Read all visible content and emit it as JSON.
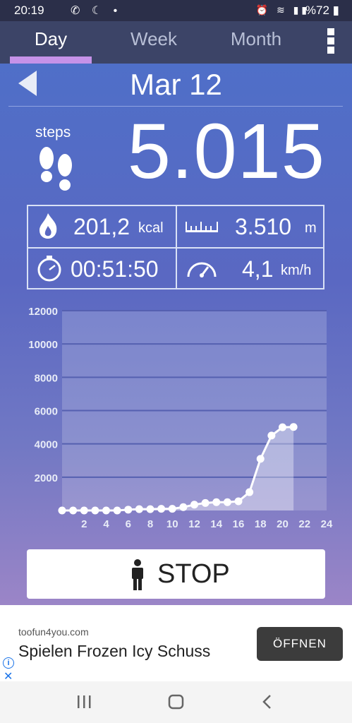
{
  "status_bar": {
    "time": "20:19",
    "left_icons": "whatsapp-icon moon-icon dot",
    "battery_text": "%72"
  },
  "tabs": [
    {
      "label": "Day",
      "active": true
    },
    {
      "label": "Week",
      "active": false
    },
    {
      "label": "Month",
      "active": false
    }
  ],
  "date": "Mar 12",
  "steps": {
    "label": "steps",
    "value": "5.015"
  },
  "stats": {
    "calories": {
      "value": "201,2",
      "unit": "kcal"
    },
    "distance": {
      "value": "3.510",
      "unit": "m"
    },
    "duration": {
      "value": "00:51:50"
    },
    "speed": {
      "value": "4,1",
      "unit": "km/h"
    }
  },
  "chart_data": {
    "type": "line",
    "x": [
      0,
      1,
      2,
      3,
      4,
      5,
      6,
      7,
      8,
      9,
      10,
      11,
      12,
      13,
      14,
      15,
      16,
      17,
      18,
      19,
      20,
      21
    ],
    "values": [
      0,
      0,
      0,
      0,
      0,
      0,
      50,
      80,
      80,
      100,
      100,
      200,
      350,
      450,
      500,
      500,
      550,
      1100,
      3100,
      4500,
      5000,
      5015
    ],
    "x_ticks": [
      "2",
      "4",
      "6",
      "8",
      "10",
      "12",
      "14",
      "16",
      "18",
      "20",
      "22",
      "24"
    ],
    "y_ticks": [
      "2000",
      "4000",
      "6000",
      "8000",
      "10000",
      "12000"
    ],
    "xlim": [
      0,
      24
    ],
    "ylim": [
      0,
      12000
    ],
    "grid": true
  },
  "stop_button": {
    "label": "STOP"
  },
  "ad": {
    "domain": "toofun4you.com",
    "headline": "Spielen Frozen Icy Schuss",
    "button": "ÖFFNEN"
  },
  "colors": {
    "accent_underline": "#c592e8",
    "tab_bar": "#3c4467",
    "gradient_top": "#4f6fc8",
    "gradient_bottom": "#9b85c7"
  }
}
